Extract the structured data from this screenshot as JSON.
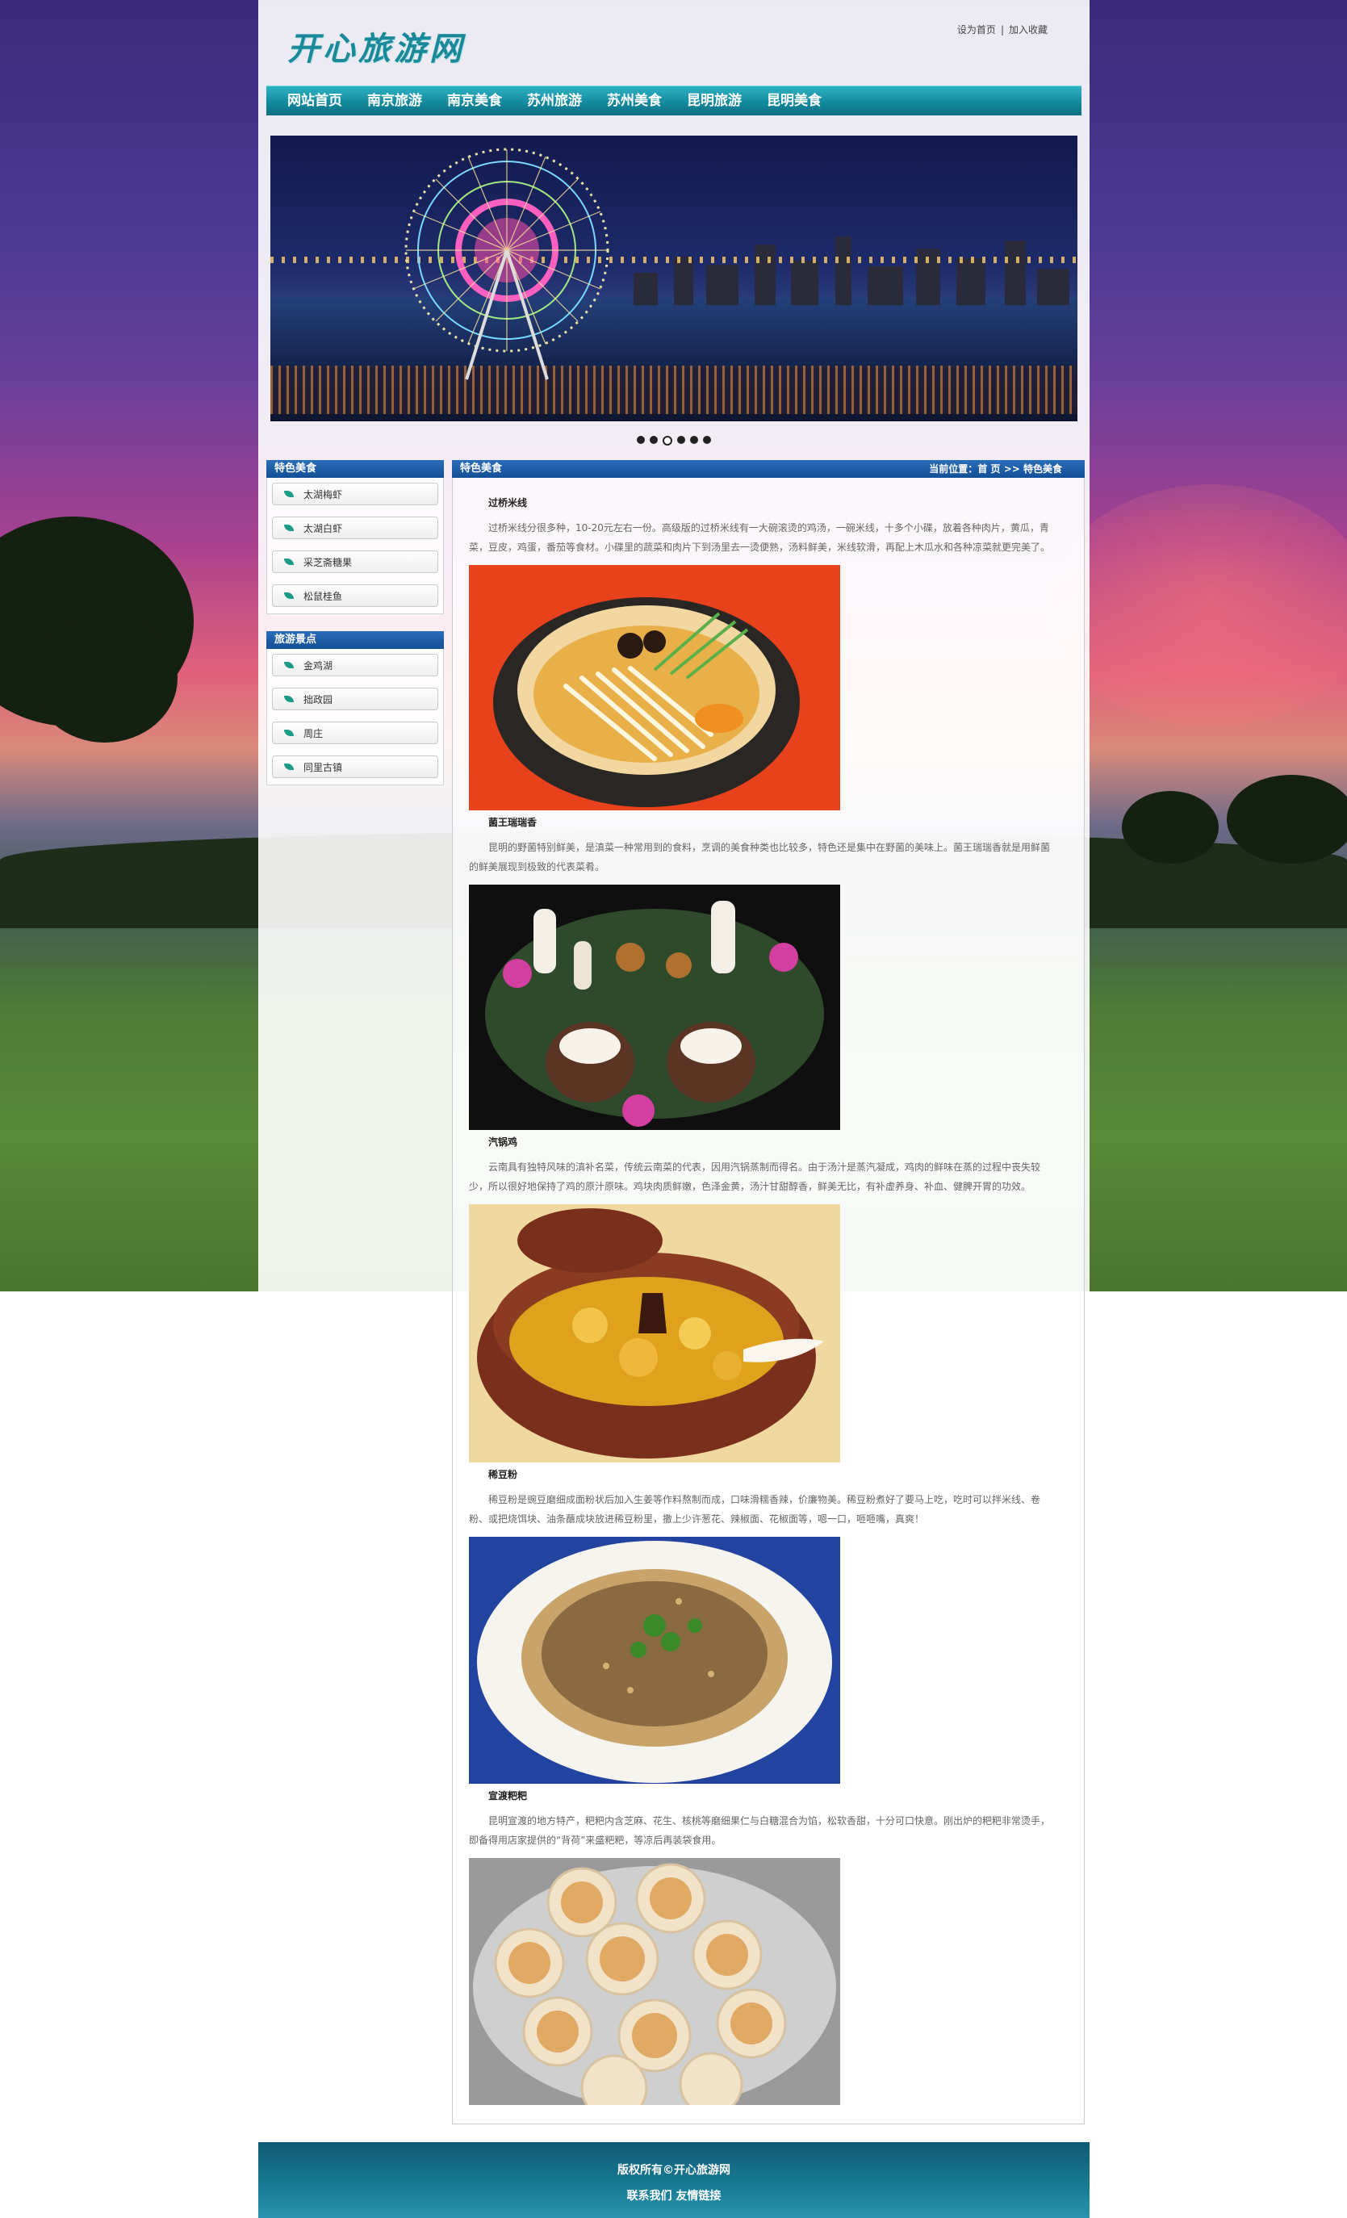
{
  "site": {
    "logo": "开心旅游网",
    "set_home": "设为首页",
    "separator": "|",
    "add_favorite": "加入收藏"
  },
  "nav": {
    "items": [
      "网站首页",
      "南京旅游",
      "南京美食",
      "苏州旅游",
      "苏州美食",
      "昆明旅游",
      "昆明美食"
    ]
  },
  "banner": {
    "slide_count": 6,
    "active_index": 2
  },
  "sidebar": {
    "food": {
      "title": "特色美食",
      "items": [
        "太湖梅虾",
        "太湖白虾",
        "采芝斋糖果",
        "松鼠桂鱼"
      ]
    },
    "spots": {
      "title": "旅游景点",
      "items": [
        "金鸡湖",
        "拙政园",
        "周庄",
        "同里古镇"
      ]
    }
  },
  "main": {
    "title": "特色美食",
    "breadcrumb": {
      "prefix": "当前位置：",
      "home": "首 页",
      "arrow": ">>",
      "current": "特色美食"
    },
    "foods": [
      {
        "name": "过桥米线",
        "desc": "过桥米线分很多种，10-20元左右一份。高级版的过桥米线有一大碗滚烫的鸡汤，一碗米线，十多个小碟，放着各种肉片，黄瓜，青菜，豆皮，鸡蛋，番茄等食材。小碟里的蔬菜和肉片下到汤里去一烫便熟，汤料鲜美，米线软滑，再配上木瓜水和各种凉菜就更完美了。"
      },
      {
        "name": "菌王瑞瑞香",
        "desc": "昆明的野菌特别鲜美，是滇菜一种常用到的食料，烹调的美食种类也比较多，特色还是集中在野菌的美味上。菌王瑞瑞香就是用鲜菌的鲜美展现到极致的代表菜肴。"
      },
      {
        "name": "汽锅鸡",
        "desc": "云南具有独特风味的滇补名菜，传统云南菜的代表，因用汽锅蒸制而得名。由于汤汁是蒸汽凝成，鸡肉的鲜味在蒸的过程中丧失较少，所以很好地保持了鸡的原汁原味。鸡块肉质鲜嫩，色泽金黄，汤汁甘甜醇香，鲜美无比，有补虚养身、补血、健脾开胃的功效。"
      },
      {
        "name": "稀豆粉",
        "desc": "稀豆粉是豌豆磨细成面粉状后加入生姜等作料熬制而成，口味滑糯香辣，价廉物美。稀豆粉煮好了要马上吃，吃时可以拌米线、卷粉、或把烧饵块、油条蘸成块放进稀豆粉里，撒上少许葱花、辣椒面、花椒面等，嗯一口，咂咂嘴，真爽！"
      },
      {
        "name": "宣渡粑粑",
        "desc": "昆明宣渡的地方特产，粑粑内含芝麻、花生、核桃等磨细果仁与白糖混合为馅，松软香甜，十分可口快意。刚出炉的粑粑非常烫手，即备得用店家提供的“背荷”来盛粑粑，等凉后再装袋食用。"
      }
    ]
  },
  "footer": {
    "copyright": "版权所有©开心旅游网",
    "contact": "联系我们",
    "links": "友情链接"
  },
  "colors": {
    "nav_teal": "#148a9e",
    "title_blue": "#1f5fa8",
    "footer_teal": "#1a7c96"
  }
}
